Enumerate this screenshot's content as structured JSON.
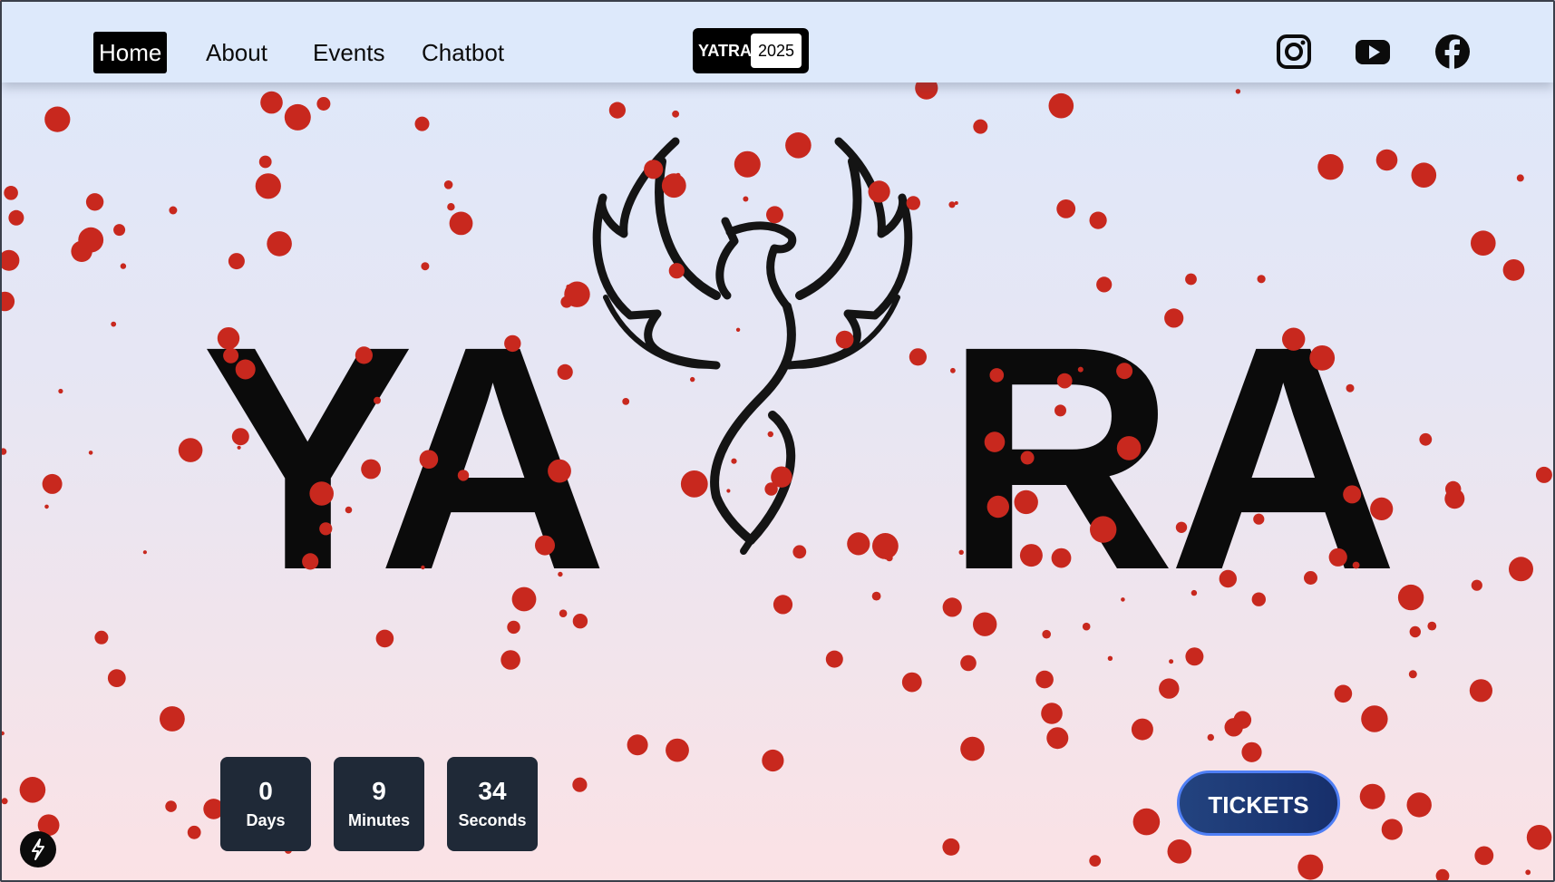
{
  "nav": {
    "items": [
      {
        "label": "Home",
        "active": true
      },
      {
        "label": "About",
        "active": false
      },
      {
        "label": "Events",
        "active": false
      },
      {
        "label": "Chatbot",
        "active": false
      }
    ],
    "brand": {
      "name": "YATRA",
      "year": "2025"
    },
    "social_icons": [
      "instagram-icon",
      "youtube-icon",
      "facebook-icon"
    ]
  },
  "hero": {
    "left_text": "YA",
    "right_text": "RA",
    "logo_icon": "phoenix-icon"
  },
  "countdown": [
    {
      "value": "0",
      "label": "Days"
    },
    {
      "value": "9",
      "label": "Minutes"
    },
    {
      "value": "34",
      "label": "Seconds"
    }
  ],
  "cta": {
    "tickets_label": "TICKETS"
  },
  "colors": {
    "dot": "#c8281e",
    "text": "#0b0b0b",
    "countdown_bg": "#1f2937",
    "button": "#1f3a78",
    "button_border": "#4f7ff5"
  },
  "widget": {
    "icon": "bolt-icon"
  }
}
